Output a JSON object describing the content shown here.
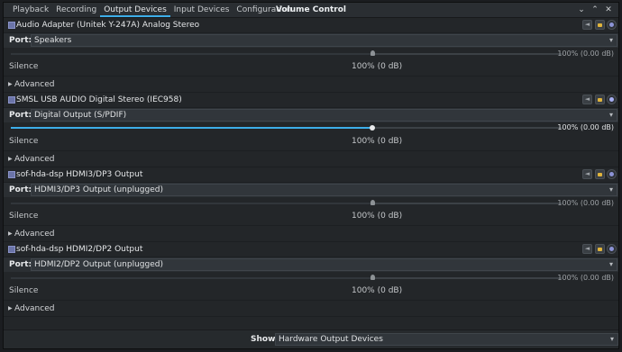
{
  "window": {
    "title": "Volume Control",
    "controls": {
      "minimize": "⌄",
      "maximize": "⌃",
      "close": "✕"
    }
  },
  "tabs": [
    {
      "label": "Playback",
      "active": false
    },
    {
      "label": "Recording",
      "active": false
    },
    {
      "label": "Output Devices",
      "active": true
    },
    {
      "label": "Input Devices",
      "active": false
    },
    {
      "label": "Configuration",
      "active": false
    }
  ],
  "colors": {
    "accent": "#3daee9",
    "background": "#232629",
    "lock": "#e0b43c"
  },
  "devices": [
    {
      "name": "Audio Adapter (Unitek Y-247A) Analog Stereo",
      "port_label": "Port:",
      "port": "Speakers",
      "volume_right": "100% (0.00 dB)",
      "silence": "Silence",
      "volume_center": "100% (0 dB)",
      "volume_fraction": 0.655,
      "advanced": "Advanced",
      "icons": {
        "device": "audio-card-icon",
        "mute": "speaker-icon",
        "lock": "lock-icon",
        "default": "default-check-icon"
      }
    },
    {
      "name": "SMSL USB AUDIO Digital Stereo (IEC958)",
      "port_label": "Port:",
      "port": "Digital Output (S/PDIF)",
      "volume_right": "100% (0.00 dB)",
      "silence": "Silence",
      "volume_center": "100% (0 dB)",
      "volume_fraction": 0.655,
      "advanced": "Advanced",
      "icons": {
        "device": "audio-card-icon",
        "mute": "speaker-icon",
        "lock": "lock-icon",
        "default": "default-check-icon"
      }
    },
    {
      "name": "sof-hda-dsp HDMI3/DP3 Output",
      "port_label": "Port:",
      "port": "HDMI3/DP3 Output (unplugged)",
      "volume_right": "100% (0.00 dB)",
      "silence": "Silence",
      "volume_center": "100% (0 dB)",
      "volume_fraction": 0.655,
      "advanced": "Advanced",
      "icons": {
        "device": "audio-card-icon",
        "mute": "speaker-icon",
        "lock": "lock-icon",
        "default": "default-check-icon"
      }
    },
    {
      "name": "sof-hda-dsp HDMI2/DP2 Output",
      "port_label": "Port:",
      "port": "HDMI2/DP2 Output (unplugged)",
      "volume_right": "100% (0.00 dB)",
      "silence": "Silence",
      "volume_center": "100% (0 dB)",
      "volume_fraction": 0.655,
      "advanced": "Advanced",
      "icons": {
        "device": "audio-card-icon",
        "mute": "speaker-icon",
        "lock": "lock-icon",
        "default": "default-check-icon"
      }
    }
  ],
  "footer": {
    "show_label": "Show:",
    "show_value": "Hardware Output Devices"
  }
}
